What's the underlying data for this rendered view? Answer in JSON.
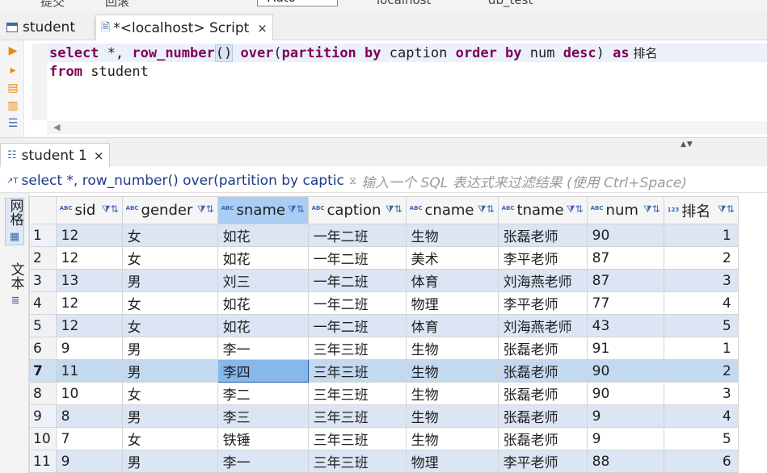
{
  "top_strip": {
    "seg_a": "提交",
    "seg_b": "回滚",
    "dropdown": "Auto",
    "seg_c": "localhost",
    "seg_d": "db_test"
  },
  "editor_tabs": [
    {
      "label": "student",
      "icon": "table-icon"
    },
    {
      "label": "*<localhost> Script",
      "icon": "script-icon",
      "close": "×"
    }
  ],
  "editor": {
    "line1": {
      "t1": "select",
      "t2": " *, ",
      "t3": "row_number",
      "t4": "()",
      "t5": " ",
      "t6": "over",
      "t7": "(",
      "t8": "partition by",
      "t9": " caption ",
      "t10": "order by",
      "t11": " num ",
      "t12": "desc",
      "t13": ") ",
      "t14": "as",
      "t15": " 排名"
    },
    "line2": {
      "t1": "from",
      "t2": " student"
    }
  },
  "results_tab": {
    "label": "student 1",
    "close": "×"
  },
  "filter": {
    "query": "select *, row_number() over(partition by captic",
    "placeholder": "输入一个 SQL 表达式来过滤结果 (使用 Ctrl+Space)"
  },
  "side_panel": {
    "grid_tab": "网格",
    "text_tab": "文本"
  },
  "table": {
    "columns": [
      {
        "type": "ABC",
        "name": "sid"
      },
      {
        "type": "ABC",
        "name": "gender"
      },
      {
        "type": "ABC",
        "name": "sname"
      },
      {
        "type": "ABC",
        "name": "caption"
      },
      {
        "type": "ABC",
        "name": "cname"
      },
      {
        "type": "ABC",
        "name": "tname"
      },
      {
        "type": "ABC",
        "name": "num"
      },
      {
        "type": "123",
        "name": "排名"
      }
    ],
    "rows": [
      [
        "1",
        "12",
        "女",
        "如花",
        "一年二班",
        "生物",
        "张磊老师",
        "90",
        "1"
      ],
      [
        "2",
        "12",
        "女",
        "如花",
        "一年二班",
        "美术",
        "李平老师",
        "87",
        "2"
      ],
      [
        "3",
        "13",
        "男",
        "刘三",
        "一年二班",
        "体育",
        "刘海燕老师",
        "87",
        "3"
      ],
      [
        "4",
        "12",
        "女",
        "如花",
        "一年二班",
        "物理",
        "李平老师",
        "77",
        "4"
      ],
      [
        "5",
        "12",
        "女",
        "如花",
        "一年二班",
        "体育",
        "刘海燕老师",
        "43",
        "5"
      ],
      [
        "6",
        "9",
        "男",
        "李一",
        "三年三班",
        "生物",
        "张磊老师",
        "91",
        "1"
      ],
      [
        "7",
        "11",
        "男",
        "李四",
        "三年三班",
        "生物",
        "张磊老师",
        "90",
        "2"
      ],
      [
        "8",
        "10",
        "女",
        "李二",
        "三年三班",
        "生物",
        "张磊老师",
        "90",
        "3"
      ],
      [
        "9",
        "8",
        "男",
        "李三",
        "三年三班",
        "生物",
        "张磊老师",
        "9",
        "4"
      ],
      [
        "10",
        "7",
        "女",
        "铁锤",
        "三年三班",
        "生物",
        "张磊老师",
        "9",
        "5"
      ],
      [
        "11",
        "9",
        "男",
        "李一",
        "三年三班",
        "物理",
        "李平老师",
        "88",
        "6"
      ]
    ],
    "selected_row": 6,
    "selected_col": 3
  }
}
